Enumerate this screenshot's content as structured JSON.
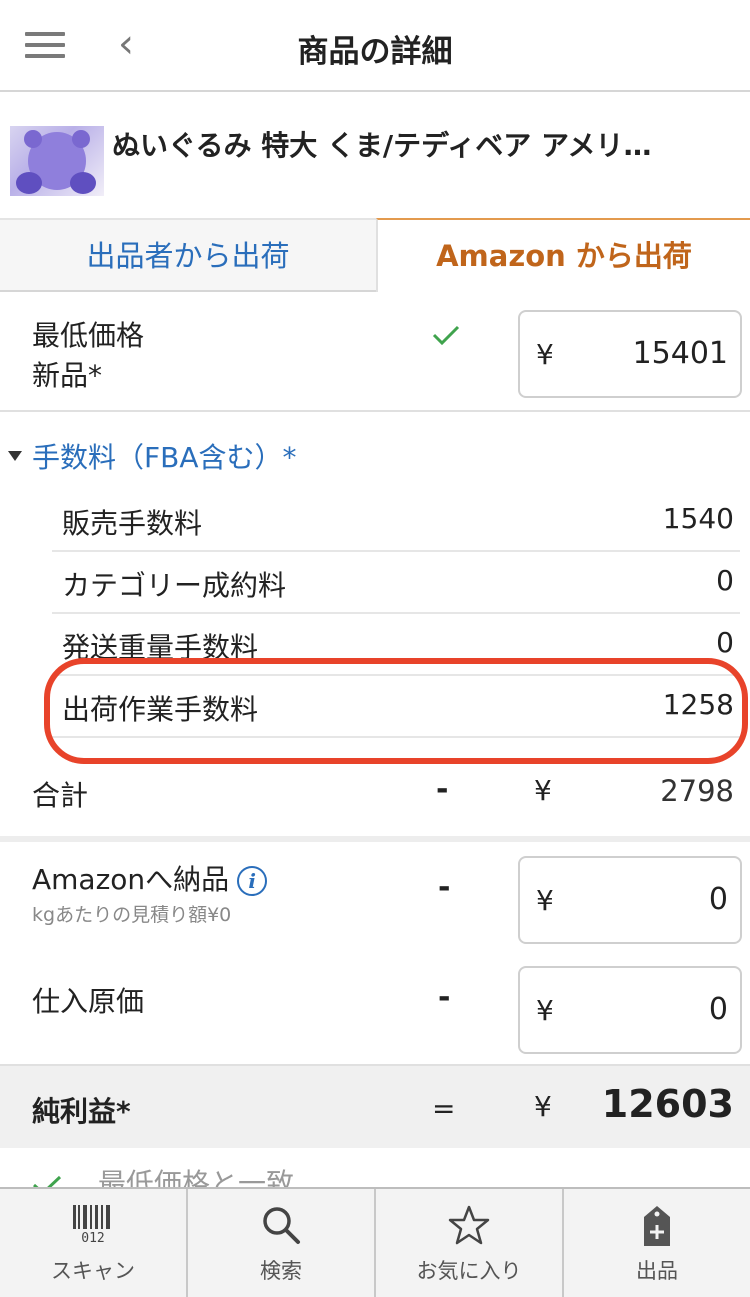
{
  "header": {
    "title": "商品の詳細",
    "back_icon": "chevron-left-icon",
    "menu_icon": "hamburger-menu-icon"
  },
  "product": {
    "title": "ぬいぐるみ 特大 くま/テディベア アメリ…"
  },
  "tabs": [
    {
      "label": "出品者から出荷",
      "active": false
    },
    {
      "label": "Amazon から出荷",
      "active": true
    }
  ],
  "min_price": {
    "label_line1": "最低価格",
    "label_line2": "新品*",
    "currency": "¥",
    "value": "15401",
    "check_color": "#3fa34d"
  },
  "fees": {
    "header": "手数料（FBA含む）*",
    "rows": [
      {
        "label": "販売手数料",
        "value": "1540"
      },
      {
        "label": "カテゴリー成約料",
        "value": "0"
      },
      {
        "label": "発送重量手数料",
        "value": "0"
      },
      {
        "label": "出荷作業手数料",
        "value": "1258"
      }
    ],
    "highlight_color": "#e8432a"
  },
  "total": {
    "label": "合計",
    "operator": "-",
    "currency": "¥",
    "value": "2798"
  },
  "amazon_ship": {
    "label": "Amazonへ納品",
    "sublabel": "kgあたりの見積り額¥0",
    "operator": "-",
    "currency": "¥",
    "value": "0"
  },
  "purchase_cost": {
    "label": "仕入原価",
    "operator": "-",
    "currency": "¥",
    "value": "0"
  },
  "profit": {
    "label": "純利益*",
    "operator": "=",
    "currency": "¥",
    "value": "12603"
  },
  "footer_note": {
    "text": "最低価格と一致"
  },
  "tabbar": [
    {
      "label": "スキャン",
      "icon": "barcode-icon",
      "barcode_text": "012"
    },
    {
      "label": "検索",
      "icon": "search-icon"
    },
    {
      "label": "お気に入り",
      "icon": "star-icon"
    },
    {
      "label": "出品",
      "icon": "listing-tag-icon"
    }
  ],
  "colors": {
    "link_blue": "#2a6ebb",
    "active_tab_orange": "#c0651b"
  }
}
